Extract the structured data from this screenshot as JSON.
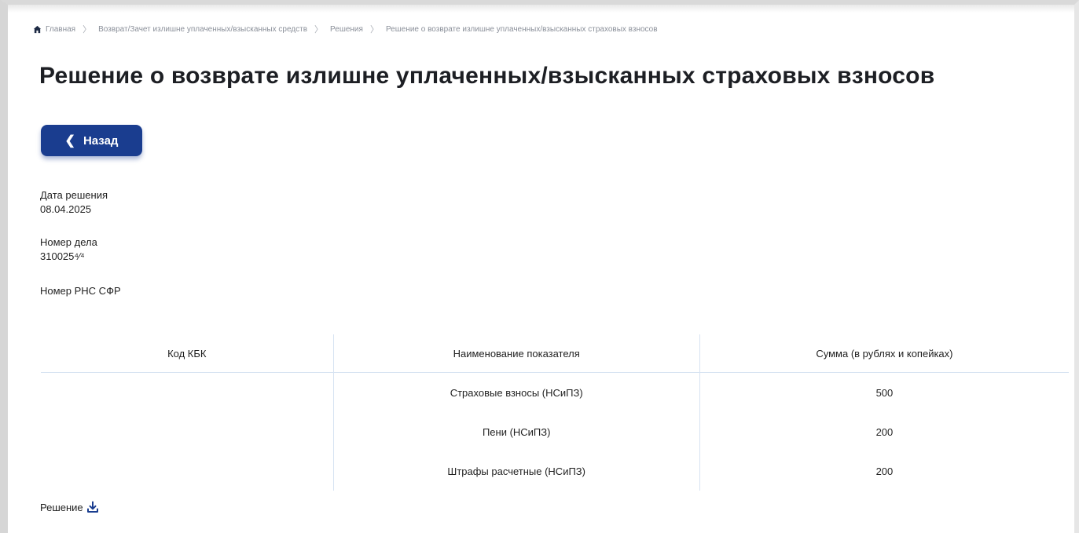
{
  "breadcrumb": {
    "items": [
      "Главная",
      "Возврат/Зачет излишне уплаченных/взысканных средств",
      "Решения",
      "Решение о возврате излишне уплаченных/взысканных страховых взносов"
    ]
  },
  "page": {
    "title": "Решение о возврате излишне уплаченных/взысканных страховых взносов",
    "back_label": "Назад"
  },
  "fields": {
    "decision_date": {
      "label": "Дата решения",
      "value": "08.04.2025"
    },
    "case_number": {
      "label": "Номер дела",
      "value": "310025⁴⁄⁴"
    },
    "rns_number": {
      "label": "Номер РНС СФР",
      "value": ""
    }
  },
  "table": {
    "headers": [
      "Код КБК",
      "Наименование показателя",
      "Сумма (в рублях и копейках)"
    ],
    "rows": [
      {
        "kbk": "",
        "name": "Страховые взносы (НСиПЗ)",
        "sum": "500"
      },
      {
        "kbk": "",
        "name": "Пени (НСиПЗ)",
        "sum": "200"
      },
      {
        "kbk": "",
        "name": "Штрафы расчетные (НСиПЗ)",
        "sum": "200"
      }
    ]
  },
  "decision_link": {
    "label": "Решение",
    "icon": "download-icon"
  },
  "colors": {
    "primary": "#1a3d8f",
    "divider": "#d7e3f2",
    "muted": "#8a8f99"
  }
}
